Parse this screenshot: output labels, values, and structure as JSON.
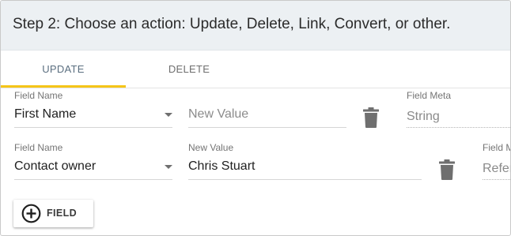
{
  "header": {
    "title": "Step 2: Choose an action: Update, Delete, Link, Convert, or other."
  },
  "tabs": [
    {
      "label": "UPDATE",
      "active": true
    },
    {
      "label": "DELETE",
      "active": false
    }
  ],
  "rows": [
    {
      "field_name_label": "Field Name",
      "field_name_value": "First Name",
      "new_value_label": "",
      "new_value_value": "",
      "new_value_placeholder": "New Value",
      "field_meta_label": "Field Meta",
      "field_meta_value": "String"
    },
    {
      "field_name_label": "Field Name",
      "field_name_value": "Contact owner",
      "new_value_label": "New Value",
      "new_value_value": "Chris Stuart",
      "new_value_placeholder": "",
      "field_meta_label": "Field M",
      "field_meta_value": "Refer"
    }
  ],
  "add_button": {
    "label": "FIELD",
    "icon": "plus-circle-icon"
  },
  "colors": {
    "header_bg": "#ecf0f3",
    "tab_indicator": "#f5c518",
    "active_tab_text": "#5b6f80",
    "icon_gray": "#6f6f6f"
  }
}
